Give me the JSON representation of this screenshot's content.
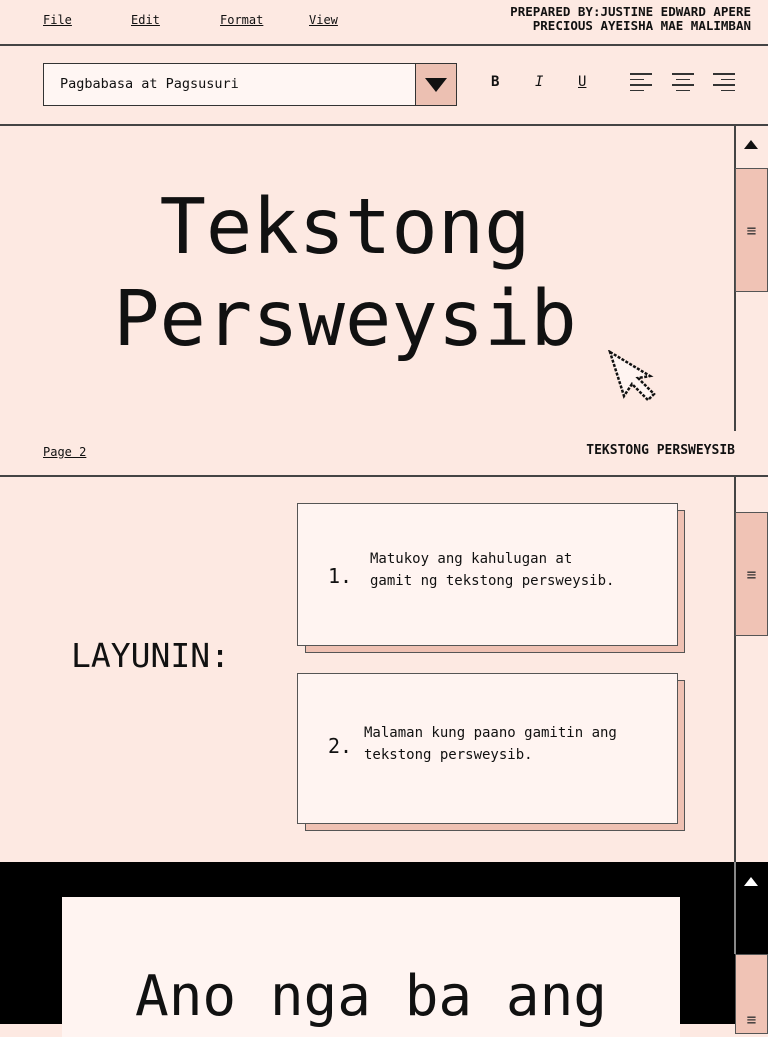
{
  "menu": {
    "file": "File",
    "edit": "Edit",
    "format": "Format",
    "view": "View"
  },
  "prepared_by": {
    "line1": "PREPARED BY:JUSTINE EDWARD APERE",
    "line2": "PRECIOUS AYEISHA MAE MALIMBAN"
  },
  "toolbar": {
    "font_select": "Pagbabasa at Pagsusuri",
    "bold": "B",
    "italic": "I",
    "underline": "U"
  },
  "slide1": {
    "title_line1": "Tekstong",
    "title_line2": "Persweysib",
    "page": "Page 2",
    "footer_title": "TEKSTONG PERSWEYSIB"
  },
  "slide2": {
    "heading": "LAYUNIN:",
    "items": [
      {
        "num": "1.",
        "text": "Matukoy ang kahulugan at gamit ng tekstong persweysib."
      },
      {
        "num": "2.",
        "text": "Malaman kung paano gamitin ang tekstong persweysib."
      }
    ]
  },
  "slide3": {
    "title": "Ano nga ba ang"
  },
  "colors": {
    "background": "#fde9e2",
    "accent": "#f0c3b5",
    "card": "#fff4f1"
  }
}
